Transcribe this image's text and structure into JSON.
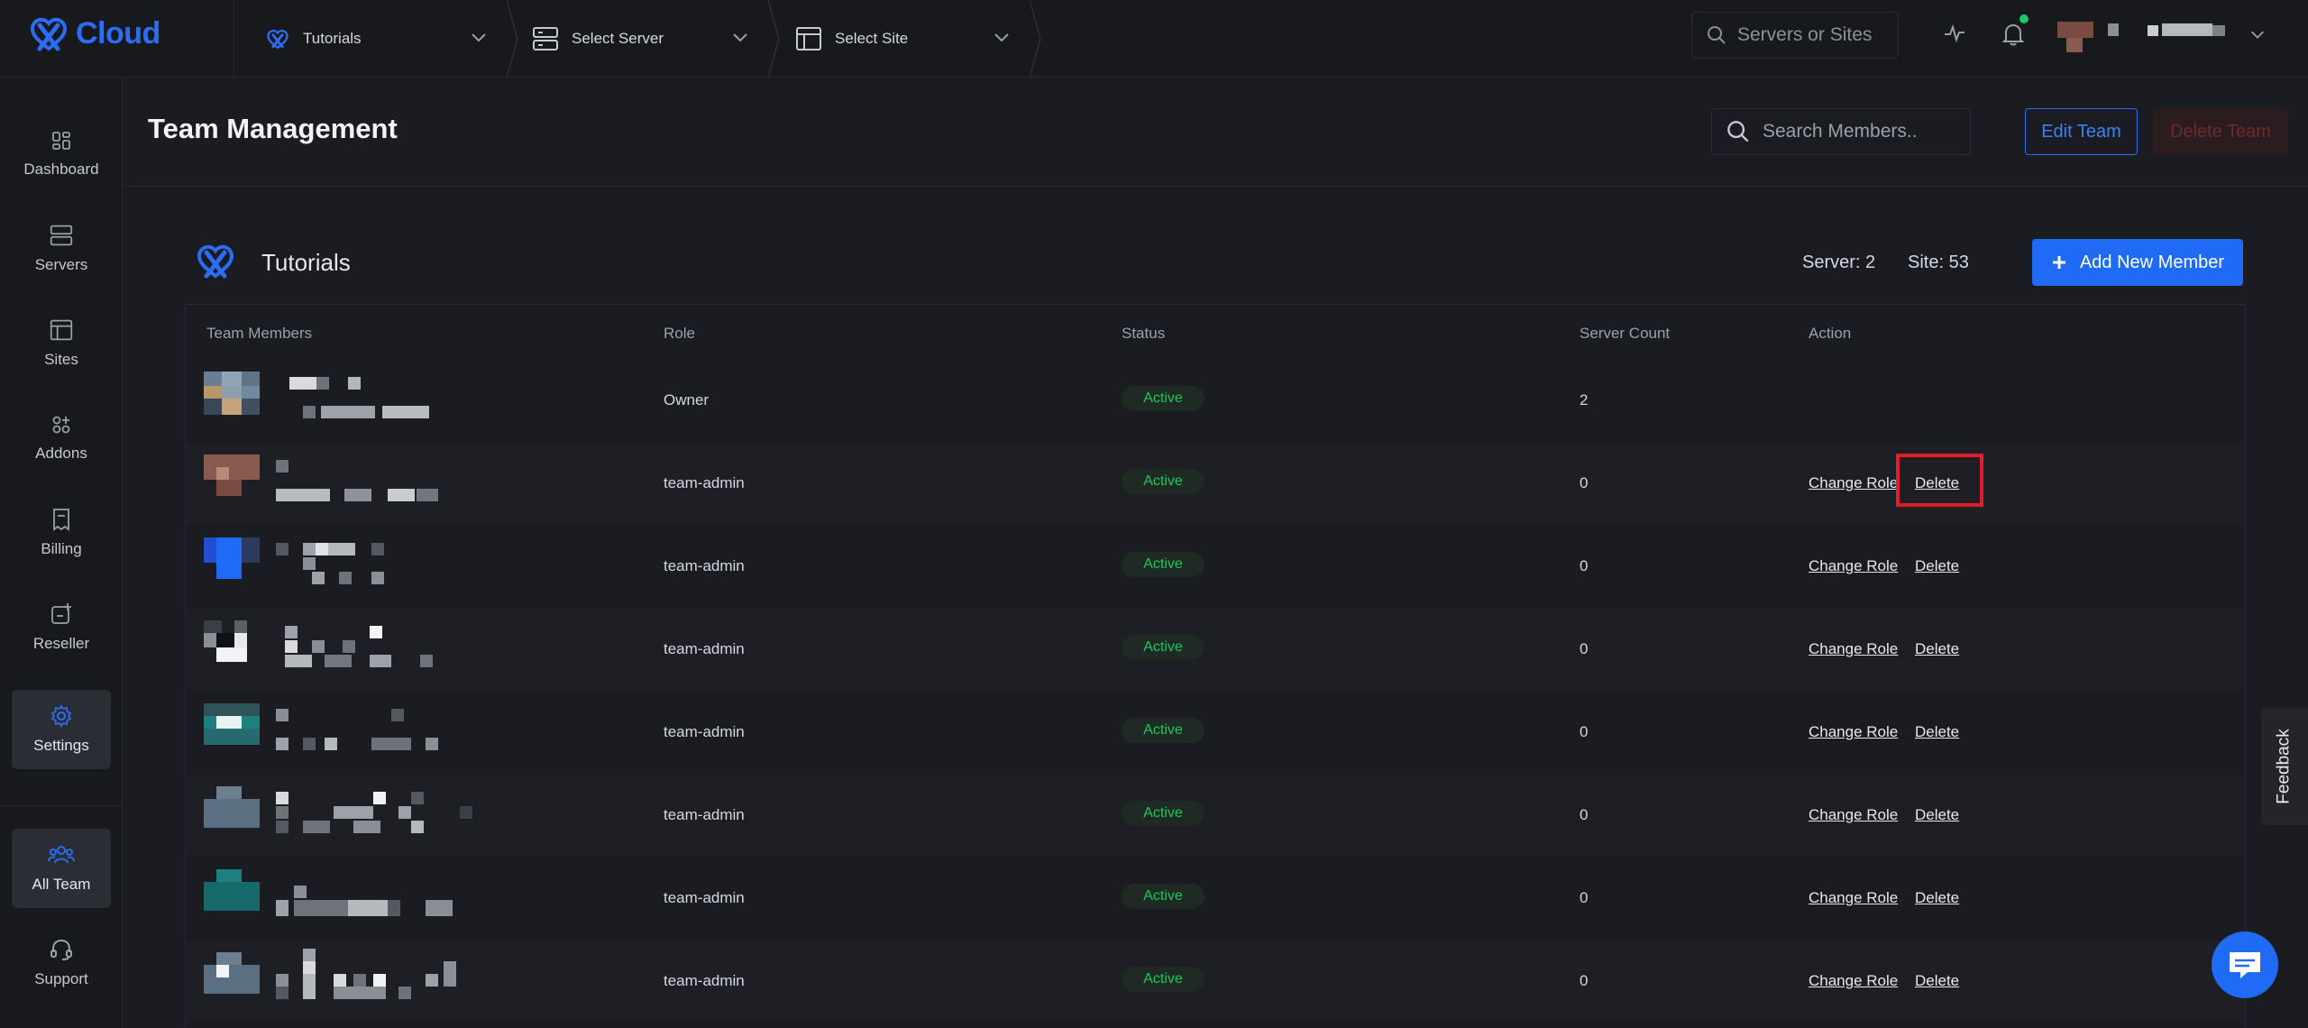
{
  "app": {
    "logo_text": "Cloud",
    "brand_color": "#2c6cf6"
  },
  "topbar": {
    "breadcrumbs": [
      {
        "label": "Tutorials",
        "icon": "xcloud-logo-icon"
      },
      {
        "label": "Select Server",
        "icon": "server-icon"
      },
      {
        "label": "Select Site",
        "icon": "browser-window-icon"
      }
    ],
    "search_placeholder": "Servers or Sites",
    "icons": [
      "activity-icon",
      "bell-icon",
      "chevron-down-icon"
    ]
  },
  "sidebar": {
    "items": [
      {
        "label": "Dashboard",
        "icon": "dashboard-icon"
      },
      {
        "label": "Servers",
        "icon": "server-icon"
      },
      {
        "label": "Sites",
        "icon": "browser-window-icon"
      },
      {
        "label": "Addons",
        "icon": "addons-icon"
      },
      {
        "label": "Billing",
        "icon": "receipt-icon"
      },
      {
        "label": "Reseller",
        "icon": "reseller-icon"
      },
      {
        "label": "Settings",
        "icon": "gear-icon",
        "active": true
      }
    ],
    "bottom_items": [
      {
        "label": "All Team",
        "icon": "team-icon",
        "active": true
      },
      {
        "label": "Support",
        "icon": "headset-icon"
      }
    ]
  },
  "header": {
    "title": "Team Management",
    "search_placeholder": "Search Members..",
    "edit_label": "Edit Team",
    "delete_label": "Delete Team"
  },
  "team": {
    "name": "Tutorials",
    "server_stat": "Server: 2",
    "site_stat": "Site: 53",
    "add_label": "Add New Member"
  },
  "table": {
    "columns": [
      "Team Members",
      "Role",
      "Status",
      "Server Count",
      "Action"
    ],
    "rows": [
      {
        "role": "Owner",
        "status": "Active",
        "server_count": "2"
      },
      {
        "role": "team-admin",
        "status": "Active",
        "server_count": "0",
        "change_role": "Change Role",
        "delete": "Delete"
      },
      {
        "role": "team-admin",
        "status": "Active",
        "server_count": "0",
        "change_role": "Change Role",
        "delete": "Delete"
      },
      {
        "role": "team-admin",
        "status": "Active",
        "server_count": "0",
        "change_role": "Change Role",
        "delete": "Delete"
      },
      {
        "role": "team-admin",
        "status": "Active",
        "server_count": "0",
        "change_role": "Change Role",
        "delete": "Delete"
      },
      {
        "role": "team-admin",
        "status": "Active",
        "server_count": "0",
        "change_role": "Change Role",
        "delete": "Delete"
      },
      {
        "role": "team-admin",
        "status": "Active",
        "server_count": "0",
        "change_role": "Change Role",
        "delete": "Delete"
      },
      {
        "role": "team-admin",
        "status": "Active",
        "server_count": "0",
        "change_role": "Change Role",
        "delete": "Delete"
      }
    ]
  },
  "feedback_label": "Feedback",
  "colors": {
    "accent": "#1f6bf5",
    "active_badge": "#22c55e",
    "highlight": "#e11d2a"
  }
}
